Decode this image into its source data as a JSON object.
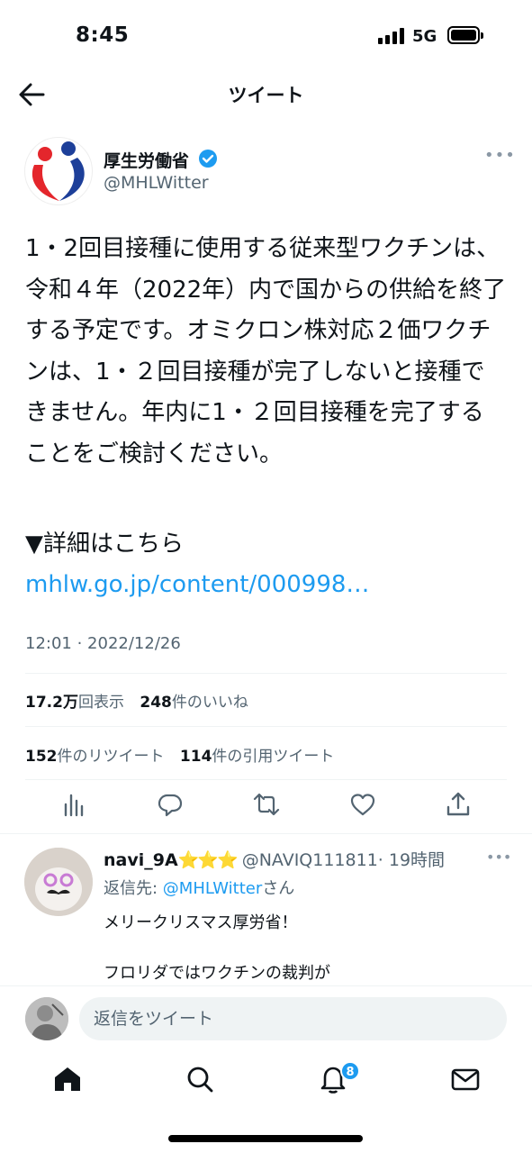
{
  "status_bar": {
    "time": "8:45",
    "network": "5G"
  },
  "header": {
    "title": "ツイート"
  },
  "tweet": {
    "author_name": "厚生労働省",
    "author_handle": "@MHLWitter",
    "text": "1・2回目接種に使用する従来型ワクチンは、令和４年（2022年）内で国からの供給を終了する予定です。オミクロン株対応２価ワクチンは、1・２回目接種が完了しないと接種できません。年内に1・２回目接種を完了することをご検討ください。",
    "detail_label": "▼詳細はこちら",
    "link_text": "mhlw.go.jp/content/000998…",
    "timestamp": "12:01 · 2022/12/26",
    "views_count": "17.2万",
    "views_label": "回表示",
    "likes_count": "248",
    "likes_label": "件のいいね",
    "retweets_count": "152",
    "retweets_label": "件のリツイート",
    "quotes_count": "114",
    "quotes_label": "件の引用ツイート"
  },
  "reply": {
    "name": "navi_9A",
    "stars": "⭐⭐⭐",
    "handle": "@NAVIQ111811",
    "time": "· 19時間",
    "reply_to_label": "返信先: ",
    "reply_to_handle": "@MHLWitter",
    "reply_to_suffix": "さん",
    "text_line1": "メリークリスマス厚労省！",
    "text_line2": "フロリダではワクチンの裁判が"
  },
  "composer": {
    "placeholder": "返信をツイート"
  },
  "tab_bar": {
    "notifications_badge": "8"
  },
  "colors": {
    "accent": "#1d9bf0",
    "text": "#0f1419",
    "secondary": "#536471"
  },
  "icons": [
    "back-arrow-icon",
    "verified-badge-icon",
    "more-icon",
    "views-icon",
    "reply-icon",
    "retweet-icon",
    "like-icon",
    "share-icon",
    "home-icon",
    "search-icon",
    "notifications-icon",
    "messages-icon"
  ]
}
